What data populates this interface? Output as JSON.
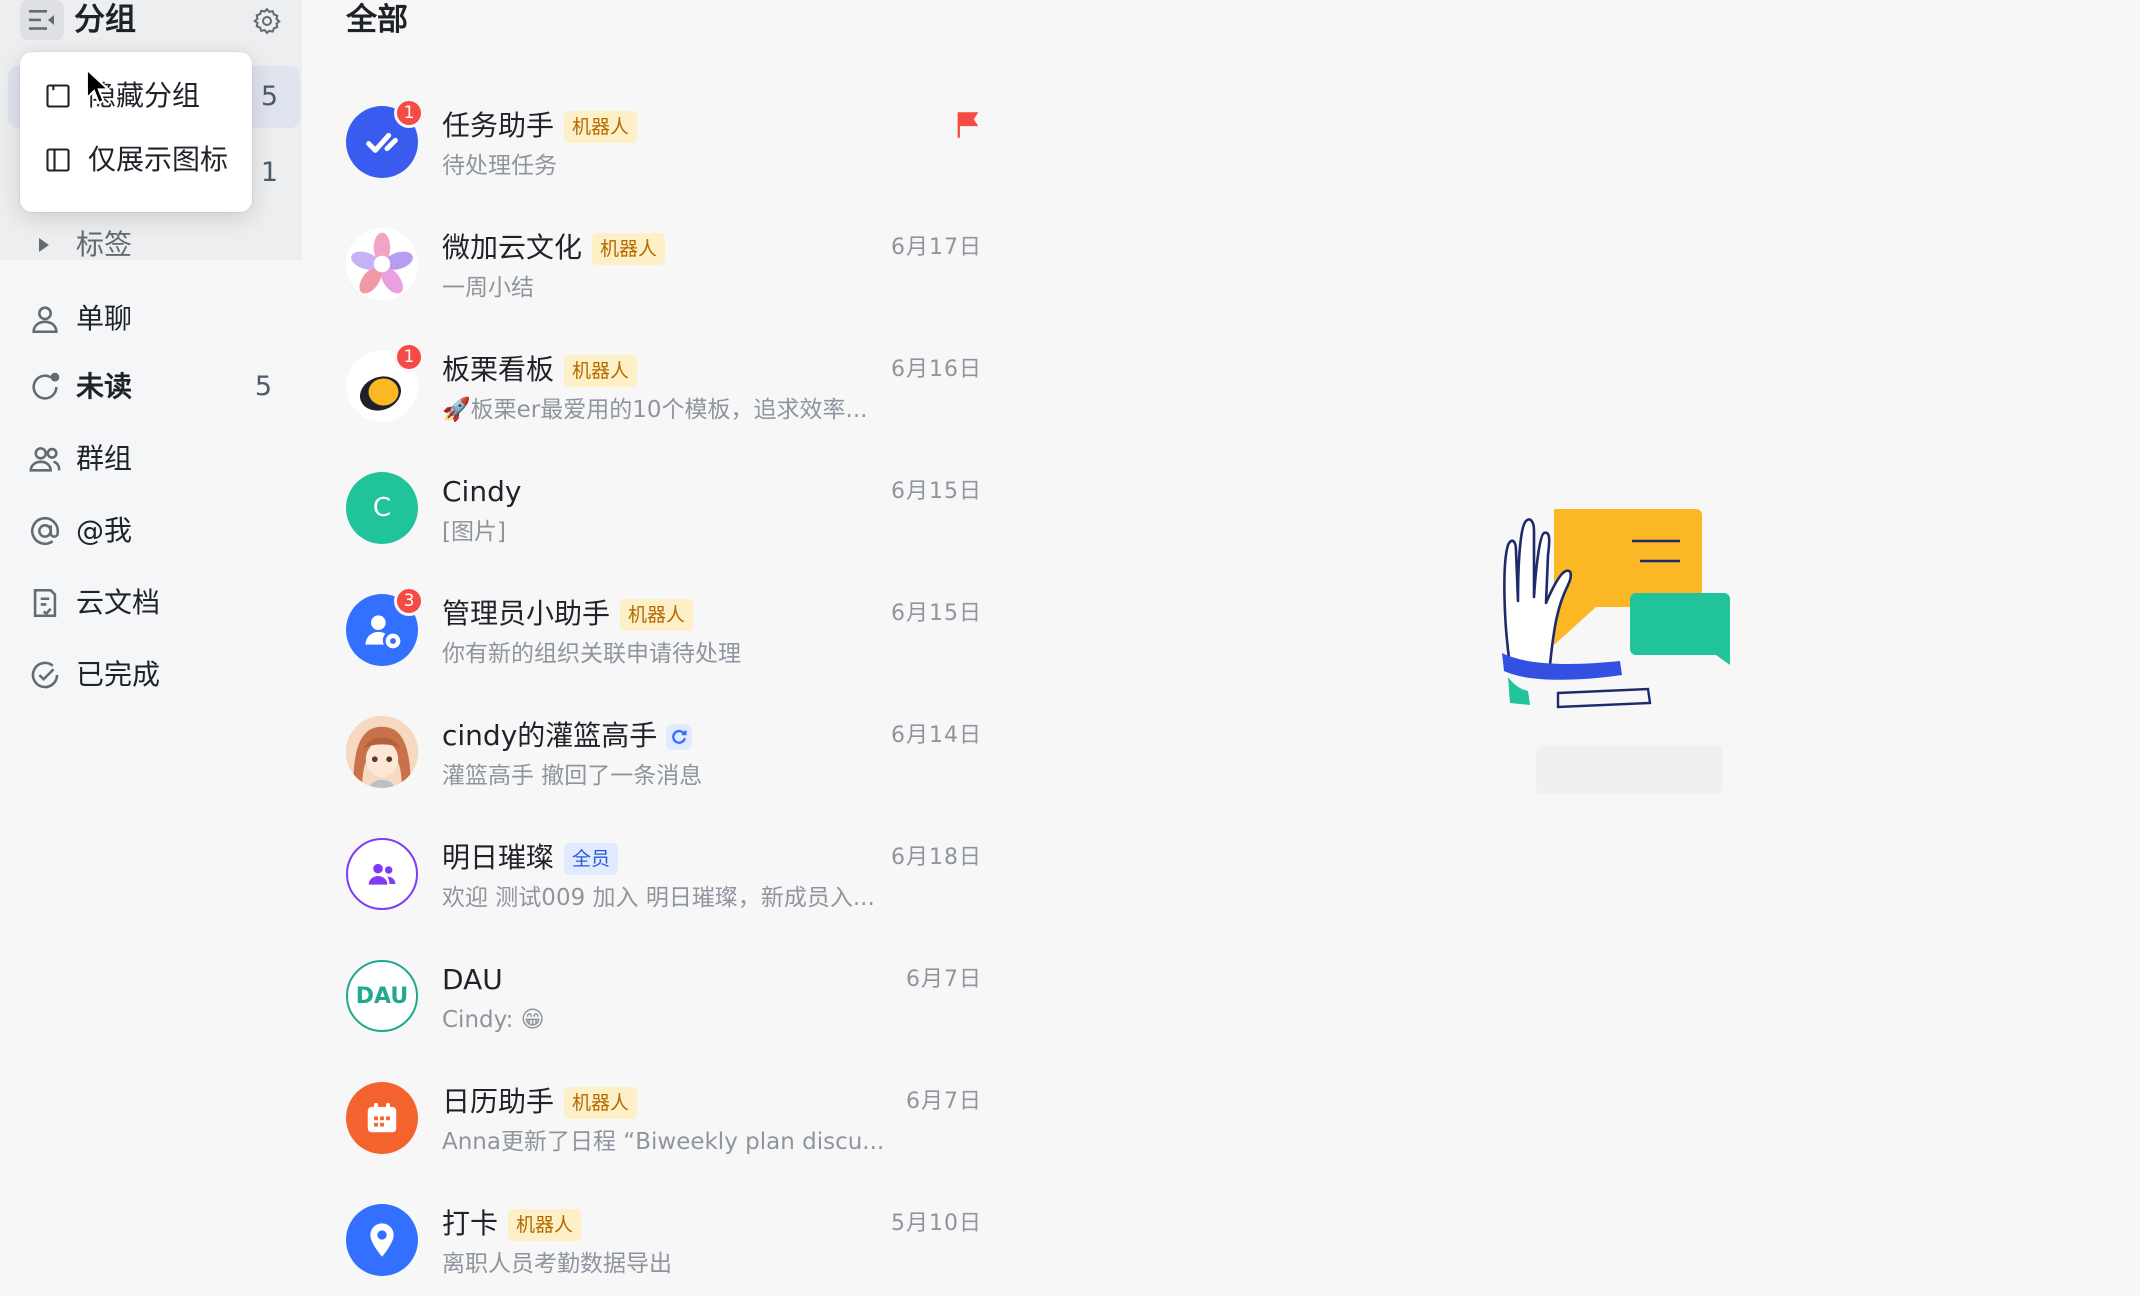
{
  "sidebar": {
    "title": "分组",
    "group_counts": [
      "5",
      "1"
    ],
    "tag_label": "标签",
    "items": [
      {
        "label": "单聊",
        "count": "",
        "icon": "person-icon"
      },
      {
        "label": "未读",
        "count": "5",
        "icon": "unread-icon"
      },
      {
        "label": "群组",
        "count": "",
        "icon": "group-icon"
      },
      {
        "label": "@我",
        "count": "",
        "icon": "at-icon"
      },
      {
        "label": "云文档",
        "count": "",
        "icon": "doc-icon"
      },
      {
        "label": "已完成",
        "count": "",
        "icon": "done-icon"
      }
    ]
  },
  "popup_menu": {
    "items": [
      {
        "label": "隐藏分组",
        "icon": "hide-panel-icon"
      },
      {
        "label": "仅展示图标",
        "icon": "icon-only-icon"
      }
    ]
  },
  "list": {
    "title": "全部",
    "conversations": [
      {
        "name": "任务助手",
        "tag": "机器人",
        "preview": "待处理任务",
        "time": "",
        "badge": "1",
        "flag": true,
        "avatar": "task-assistant-avatar",
        "avatar_color": "#3a5bf0"
      },
      {
        "name": "微加云文化",
        "tag": "机器人",
        "preview": "一周小结",
        "time": "6月17日",
        "badge": "",
        "avatar": "flower-avatar",
        "avatar_color": "#ffffff"
      },
      {
        "name": "板栗看板",
        "tag": "机器人",
        "preview": "🚀板栗er最爱用的10个模板，追求效率...",
        "time": "6月16日",
        "badge": "1",
        "avatar": "chestnut-avatar",
        "avatar_color": "#ffffff"
      },
      {
        "name": "Cindy",
        "tag": "",
        "preview": "[图片]",
        "time": "6月15日",
        "badge": "",
        "avatar_text": "C",
        "avatar": "letter-avatar",
        "avatar_color": "#21c49a"
      },
      {
        "name": "管理员小助手",
        "tag": "机器人",
        "preview": "你有新的组织关联申请待处理",
        "time": "6月15日",
        "badge": "3",
        "avatar": "admin-assistant-avatar",
        "avatar_color": "#3370ff"
      },
      {
        "name": "cindy的灌篮高手",
        "tag": "",
        "preview": "灌篮高手 撤回了一条消息",
        "time": "6月14日",
        "badge": "",
        "avatar": "anime-avatar",
        "avatar_color": "#f3c9a8",
        "verified": true
      },
      {
        "name": "明日璀璨",
        "tag": "全员",
        "preview": "欢迎 测试009 加入 明日璀璨，新成员入...",
        "time": "6月18日",
        "badge": "",
        "avatar": "group-avatar",
        "avatar_color": "#ffffff"
      },
      {
        "name": "DAU",
        "tag": "",
        "preview": "Cindy: 😁",
        "time": "6月7日",
        "badge": "",
        "avatar_text": "DAU",
        "avatar": "dau-avatar",
        "avatar_color": "#ffffff"
      },
      {
        "name": "日历助手",
        "tag": "机器人",
        "preview": "Anna更新了日程 “Biweekly plan discu...",
        "time": "6月7日",
        "badge": "",
        "avatar": "calendar-avatar",
        "avatar_color": "#f4622e"
      },
      {
        "name": "打卡",
        "tag": "机器人",
        "preview": "离职人员考勤数据导出",
        "time": "5月10日",
        "badge": "",
        "avatar": "checkin-avatar",
        "avatar_color": "#3370ff"
      }
    ]
  },
  "colors": {
    "accent": "#3370ff",
    "badge_red": "#f54a45",
    "flag_red": "#f54a45",
    "bot_tag_bg": "#fdf0c6",
    "bot_tag_text": "#b26a00"
  }
}
